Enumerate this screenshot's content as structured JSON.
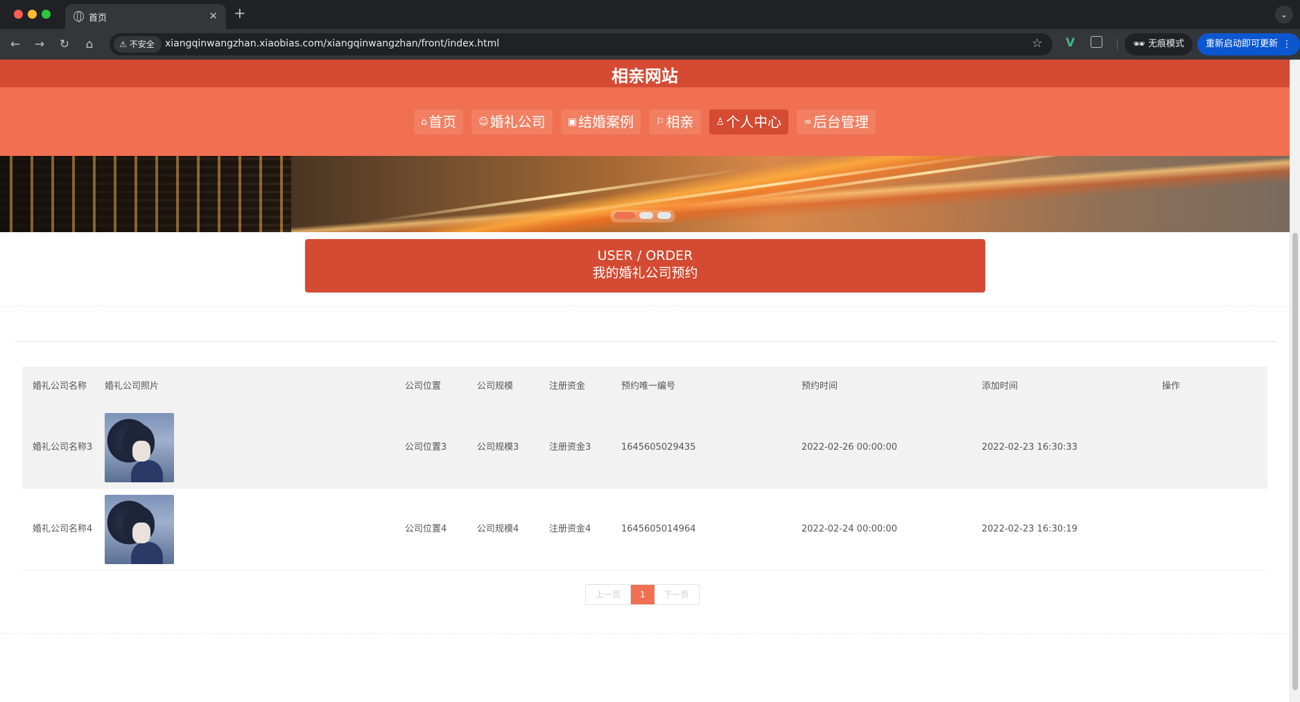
{
  "browser": {
    "tab_title": "首页",
    "close_glyph": "✕",
    "new_tab_glyph": "+",
    "security_label": "不安全",
    "url": "xiangqinwangzhan.xiaobias.com/xiangqinwangzhan/front/index.html",
    "incognito_label": "无痕模式",
    "update_label": "重新启动即可更新",
    "extension_name": "V"
  },
  "site": {
    "title": "相亲网站",
    "nav": [
      {
        "label": "首页",
        "icon": "home-icon",
        "glyph": "⌂"
      },
      {
        "label": "婚礼公司",
        "icon": "face-icon",
        "glyph": "☺"
      },
      {
        "label": "结婚案例",
        "icon": "gift-icon",
        "glyph": "▣"
      },
      {
        "label": "相亲",
        "icon": "flag-icon",
        "glyph": "⚐"
      },
      {
        "label": "个人中心",
        "icon": "user-icon",
        "glyph": "♙",
        "active": true
      },
      {
        "label": "后台管理",
        "icon": "link-icon",
        "glyph": "∞"
      }
    ],
    "carousel": {
      "slides": 3,
      "active_index": 0
    },
    "accent_color": "#d44a32",
    "nav_bg_color": "#f07051"
  },
  "section": {
    "title_en": "USER / ORDER",
    "title_cn": "我的婚礼公司预约"
  },
  "table": {
    "headers": {
      "name": "婚礼公司名称",
      "photo": "婚礼公司照片",
      "location": "公司位置",
      "scale": "公司规模",
      "capital": "注册资金",
      "code": "预约唯一编号",
      "time": "预约时间",
      "added": "添加时间",
      "op": "操作"
    },
    "rows": [
      {
        "name": "婚礼公司名称3",
        "location": "公司位置3",
        "scale": "公司规模3",
        "capital": "注册资金3",
        "code": "1645605029435",
        "time": "2022-02-26 00:00:00",
        "added": "2022-02-23 16:30:33",
        "op": ""
      },
      {
        "name": "婚礼公司名称4",
        "location": "公司位置4",
        "scale": "公司规模4",
        "capital": "注册资金4",
        "code": "1645605014964",
        "time": "2022-02-24 00:00:00",
        "added": "2022-02-23 16:30:19",
        "op": ""
      }
    ]
  },
  "pagination": {
    "prev": "上一页",
    "current": "1",
    "next": "下一页"
  }
}
